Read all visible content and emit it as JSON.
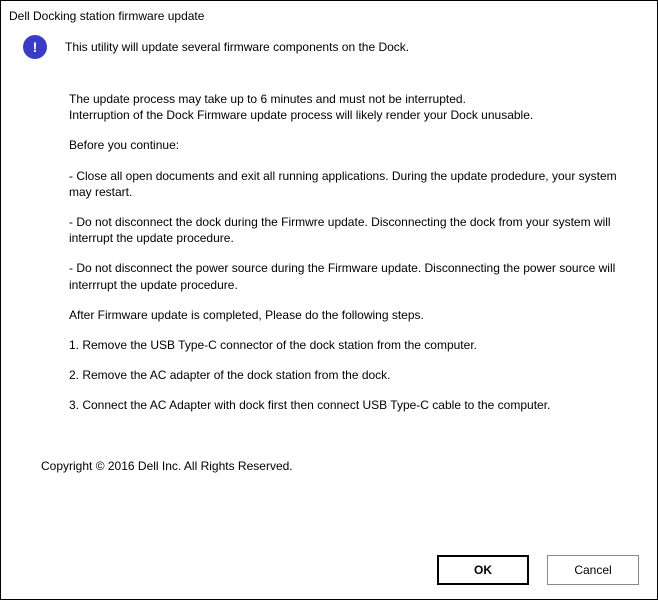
{
  "title": "Dell Docking station firmware update",
  "header": "This utility will update several firmware components on the Dock.",
  "body": {
    "p1a": "The update process may take up to 6 minutes and must not be interrupted.",
    "p1b": "Interruption of the Dock Firmware update process will likely render your Dock unusable.",
    "p2": "Before you continue:",
    "p3": "- Close all open documents and exit all running applications. During the update prodedure, your system may restart.",
    "p4": "- Do not disconnect the dock during the Firmwre update. Disconnecting the dock from your system will interrupt the update procedure.",
    "p5": "- Do not disconnect the power source during the Firmware update. Disconnecting the power source will interrrupt the update procedure.",
    "p6": "After Firmware update is completed, Please do the following steps.",
    "p7": "1. Remove the USB Type-C connector of the dock station from the computer.",
    "p8": "2. Remove the AC adapter of the dock station from the dock.",
    "p9": "3. Connect the AC Adapter with dock first then connect USB Type-C cable to the computer."
  },
  "copyright": "Copyright © 2016 Dell Inc. All Rights Reserved.",
  "buttons": {
    "ok": "OK",
    "cancel": "Cancel"
  }
}
